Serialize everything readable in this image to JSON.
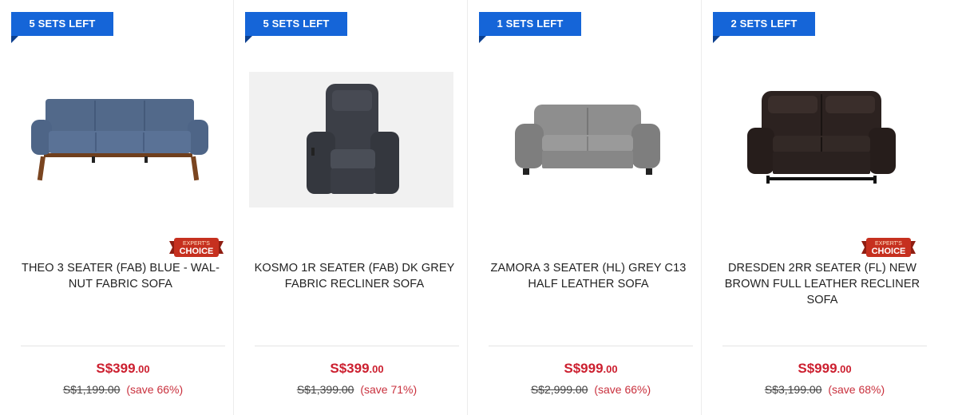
{
  "colors": {
    "badge_blue": "#1565d8",
    "price_red": "#cc1f2f",
    "expert_red": "#c6301f"
  },
  "products": [
    {
      "stock_badge": "5 SETS LEFT",
      "image_icon": "sofa-3-seater-blue-fabric",
      "expert_badge": {
        "line1": "EXPERT'S",
        "line2": "CHOICE"
      },
      "title": "THEO 3 SEATER (FAB) BLUE - WAL-NUT FABRIC SOFA",
      "price_main": "S$399",
      "price_cents": ".00",
      "price_was": "S$1,199.00",
      "price_save": "(save 66%)"
    },
    {
      "stock_badge": "5 SETS LEFT",
      "image_icon": "recliner-1-seater-dark-grey",
      "expert_badge": null,
      "title": "KOSMO 1R SEATER (FAB) DK GREY FABRIC RECLINER SOFA",
      "price_main": "S$399",
      "price_cents": ".00",
      "price_was": "S$1,399.00",
      "price_save": "(save 71%)"
    },
    {
      "stock_badge": "1 SETS LEFT",
      "image_icon": "sofa-3-seater-grey-leather",
      "expert_badge": null,
      "title": "ZAMORA 3 SEATER (HL) GREY C13 HALF LEATHER SOFA",
      "price_main": "S$999",
      "price_cents": ".00",
      "price_was": "S$2,999.00",
      "price_save": "(save 66%)"
    },
    {
      "stock_badge": "2 SETS LEFT",
      "image_icon": "sofa-2-seater-brown-leather-recliner",
      "expert_badge": {
        "line1": "EXPERT'S",
        "line2": "CHOICE"
      },
      "title": "DRESDEN 2RR SEATER (FL) NEW BROWN FULL LEATHER RECLINER SOFA",
      "price_main": "S$999",
      "price_cents": ".00",
      "price_was": "S$3,199.00",
      "price_save": "(save 68%)"
    }
  ]
}
